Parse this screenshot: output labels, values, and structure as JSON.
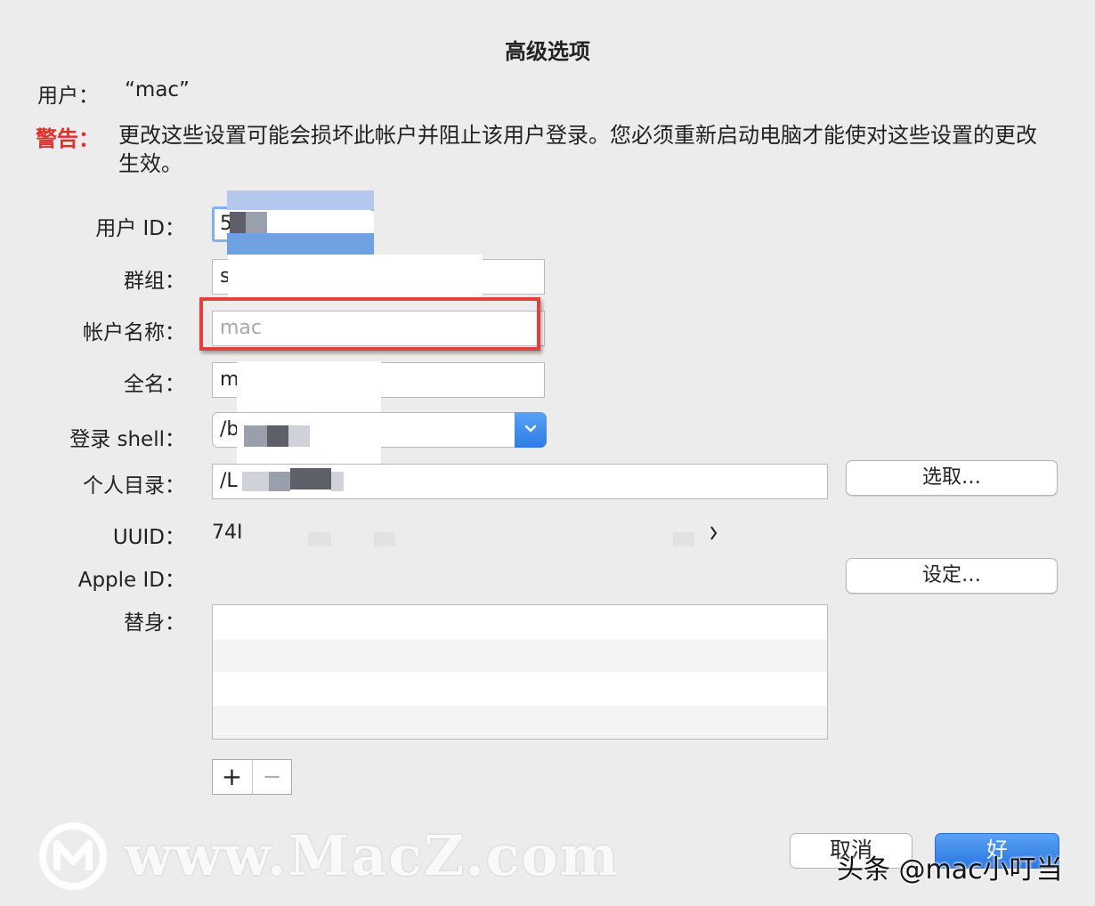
{
  "dialog": {
    "title": "高级选项",
    "user_label": "用户：",
    "user_value": "“mac”",
    "warning_label": "警告：",
    "warning_text": "更改这些设置可能会损坏此帐户并阻止该用户登录。您必须重新启动电脑才能使对这些设置的更改生效。"
  },
  "fields": {
    "user_id": {
      "label": "用户 ID：",
      "value": "5"
    },
    "group": {
      "label": "群组：",
      "value": "s"
    },
    "account_name": {
      "label": "帐户名称：",
      "placeholder": "mac"
    },
    "full_name": {
      "label": "全名：",
      "value": "m"
    },
    "login_shell": {
      "label": "登录 shell：",
      "value": "/b"
    },
    "home_dir": {
      "label": "个人目录：",
      "value": "/L"
    },
    "uuid": {
      "label": "UUID：",
      "value": "74I"
    },
    "apple_id": {
      "label": "Apple ID："
    },
    "aliases": {
      "label": "替身："
    }
  },
  "buttons": {
    "choose": "选取…",
    "set": "设定…",
    "add": "+",
    "remove": "−",
    "cancel": "取消",
    "ok": "好"
  },
  "watermark": {
    "site": "www.MacZ.com",
    "credit": "头条 @mac小叮当"
  },
  "colors": {
    "warning": "#e0302a",
    "highlight_box": "#e0413c",
    "accent": "#2d7be6"
  },
  "icons": {
    "popup": "chevron-down-icon",
    "logo": "macz-logo-icon"
  }
}
